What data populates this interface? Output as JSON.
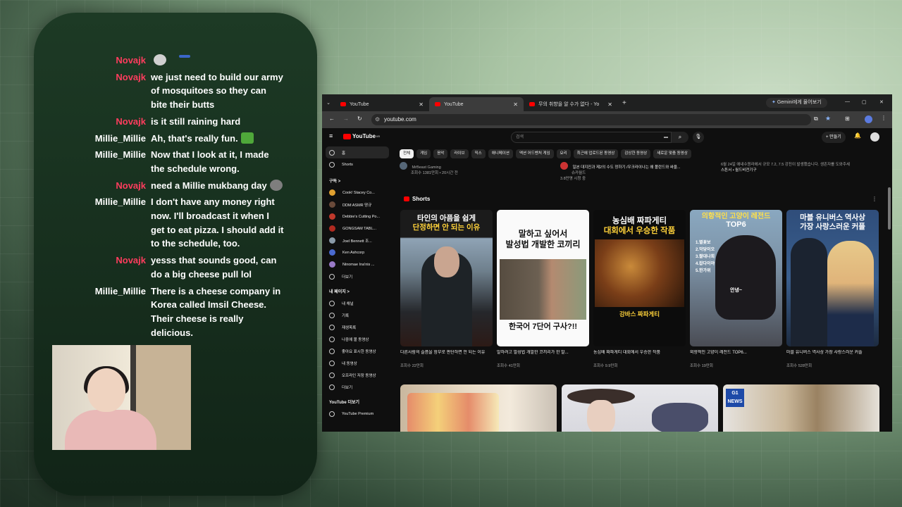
{
  "chat": [
    {
      "user": "Novajk",
      "text": "",
      "emotes": [
        "cat-emote",
        "flag-emote"
      ]
    },
    {
      "user": "Novajk",
      "text": "we just need to build our army of mosquitoes so they can bite their butts"
    },
    {
      "user": "Novajk",
      "text": "is it still raining hard"
    },
    {
      "user": "Millie_Millie",
      "text": "Ah, that's really fun.",
      "emotes": [
        "green-emote"
      ]
    },
    {
      "user": "Millie_Millie",
      "text": "Now that I look at it, I made the schedule wrong."
    },
    {
      "user": "Novajk",
      "text": "need a Millie mukbang day",
      "emotes": [
        "pig-emote"
      ]
    },
    {
      "user": "Millie_Millie",
      "text": "I don't have any money right now. I'll broadcast it when I get to eat pizza. I should add it to the schedule, too."
    },
    {
      "user": "Novajk",
      "text": "yesss that sounds good, can do a big cheese pull lol"
    },
    {
      "user": "Millie_Millie",
      "text": "There is a cheese company in Korea called Imsil Cheese. Their cheese is really delicious."
    }
  ],
  "browser": {
    "tabs": [
      {
        "label": "YouTube",
        "active": false
      },
      {
        "label": "YouTube",
        "active": true
      },
      {
        "label": "무의 취향을 알 수가 없다 - Yo",
        "active": false
      }
    ],
    "gemini_label": "Gemini에게 물어보기",
    "url": "youtube.com"
  },
  "youtube": {
    "logo": "YouTube",
    "logo_sup": "KR",
    "search_placeholder": "검색",
    "create_label": "+ 만들기",
    "sidebar": {
      "main": [
        {
          "label": "홈",
          "icon": "home-icon",
          "active": true
        },
        {
          "label": "Shorts",
          "icon": "shorts-icon",
          "active": false
        }
      ],
      "subs_header": "구독 >",
      "subs": [
        {
          "label": "Cook! Stacey Co...",
          "color": "#e0a030"
        },
        {
          "label": "DDM ASMR 땅규",
          "color": "#6a4a3a"
        },
        {
          "label": "Debbie's Cutting Po...",
          "color": "#c0382b"
        },
        {
          "label": "GONGSAM TABL...",
          "color": "#b02a20"
        },
        {
          "label": "Joel Bennett 조...",
          "color": "#8a9aa8"
        },
        {
          "label": "Ken Ashcorp",
          "color": "#4a6ad0"
        },
        {
          "label": "Ninomae Ina'nis ...",
          "color": "#9a7ac8"
        },
        {
          "label": "더보기",
          "color": ""
        }
      ],
      "me_header": "내 페이지 >",
      "me": [
        "내 채널",
        "기록",
        "재생목록",
        "나중에 볼 동영상",
        "좋아요 표시한 동영상",
        "내 동영상",
        "오프라인 저장 동영상",
        "더보기"
      ],
      "more_header": "YouTube 더보기",
      "more": [
        "YouTube Premium"
      ]
    },
    "chips": [
      "전체",
      "게임",
      "음악",
      "라이브",
      "믹스",
      "애니메이션",
      "액션 어드벤처 게임",
      "요리",
      "최근에 업로드된 동영상",
      "감상한 동영상",
      "새로운 맞춤 동영상"
    ],
    "previous_row": [
      {
        "line1": "MrBeast Gaming",
        "line2": "조회수 1381만회 • 20시간 전"
      },
      {
        "line1": "일본 대지진과 제2의 수도 정하기 /우크라이나는 왜 폴란드와 싸울...",
        "line2": "슈카월드",
        "line3": "3.8만명 시청 중"
      },
      {
        "line1": "6월 24일 애내수원라에서 규모 7.2, 7.5 강진이 발생했습니다. 생존자를 도와주세",
        "line2": "스튼서 • 월드비전기구"
      }
    ],
    "shorts_heading": "Shorts",
    "shorts": [
      {
        "caption_top": "타인의 아픔을 쉽게",
        "caption_top2": "단정하면 안 되는 이유",
        "title": "다른사람의 슬픔을 함부로 판단하면 안 되는 이유",
        "views": "조회수 22만회"
      },
      {
        "caption_top": "말하고 싶어서",
        "caption_top2": "발성법 개발한 코끼리",
        "caption_bottom": "한국어 7단어 구사?!!",
        "title": "말하려고 발성법 개발한 코끼리가 한 말...",
        "views": "조회수 41만회"
      },
      {
        "caption_top": "농심배 짜파게티",
        "caption_top2": "대회에서 우승한 작품",
        "caption_bottom": "강바스 짜파게티",
        "title": "농심배 짜파게티 대회에서 우승한 작품",
        "views": "조회수 9.9만회"
      },
      {
        "caption_top": "의항적인 고양이 레전드",
        "caption_top2": "TOP6",
        "caption_list": "1.별꽃보\n2.악당이오\n3.짤대나희\n4.잡다이야\n5.한가위",
        "caption_mid": "안녕~",
        "title": "외향적인 고양이 레전드 TOP6...",
        "views": "조회수 19만회"
      },
      {
        "caption_top": "마블 유니버스 역사상",
        "caption_top2": "가장 사랑스러운 커플",
        "title": "마블 유니버스 역사상 가장 사랑스러운 커플",
        "views": "조회수 528만회"
      }
    ],
    "bottom_badge": "G1 NEWS"
  }
}
